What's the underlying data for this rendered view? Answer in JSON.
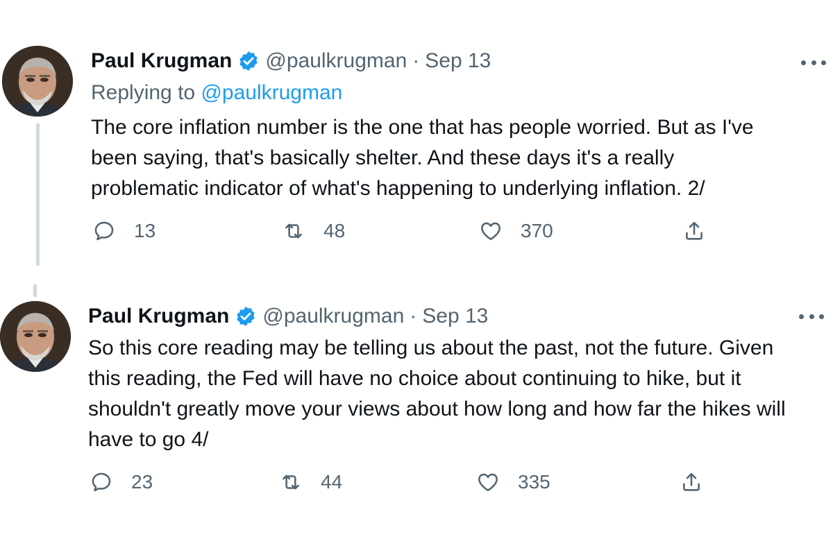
{
  "accent_color": "#1d9bf0",
  "tweets": [
    {
      "author_name": "Paul Krugman",
      "verified_icon": "verified-badge-icon",
      "handle": "@paulkrugman",
      "separator": "·",
      "time": "Sep 13",
      "replying_prefix": "Replying to",
      "replying_to": "@paulkrugman",
      "text_lines": [
        "The core inflation number is the one that has people worried. But as I've",
        "been saying, that's basically shelter. And these days it's a really",
        "problematic indicator of what's happening to underlying inflation. 2/"
      ],
      "replies": "13",
      "retweets": "48",
      "likes": "370"
    },
    {
      "author_name": "Paul Krugman",
      "verified_icon": "verified-badge-icon",
      "handle": "@paulkrugman",
      "separator": "·",
      "time": "Sep 13",
      "text_lines": [
        "So this core reading may be telling us about the past, not the future. Given",
        "this reading, the Fed will have no choice about continuing to hike, but it",
        "shouldn't greatly move your views about how long and how far the hikes will",
        "have to go 4/"
      ],
      "replies": "23",
      "retweets": "44",
      "likes": "335"
    }
  ]
}
